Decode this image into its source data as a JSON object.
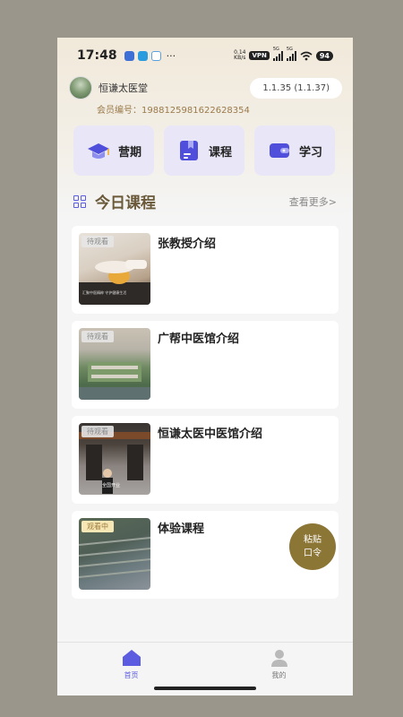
{
  "status_bar": {
    "time": "17:48",
    "dots": "···",
    "net_speed_value": "0.14",
    "net_speed_unit": "KB/s",
    "vpn": "VPN",
    "sig1_tag": "5G",
    "sig2_tag": "5G",
    "battery": "94"
  },
  "header": {
    "org_name": "恒谦太医堂",
    "version": "1.1.35 (1.1.37)",
    "member_label": "会员编号：",
    "member_id": "1988125981622628354"
  },
  "quick_cards": [
    {
      "label": "营期",
      "icon": "graduation-cap-icon"
    },
    {
      "label": "课程",
      "icon": "bookmark-doc-icon"
    },
    {
      "label": "学习",
      "icon": "wallet-icon"
    }
  ],
  "section": {
    "title": "今日课程",
    "more": "查看更多>"
  },
  "courses": [
    {
      "title": "张教授介绍",
      "badge": "待观看",
      "thumb_caption": "汇聚中医精粹 守护健康生活"
    },
    {
      "title": "广帮中医馆介绍",
      "badge": "待观看"
    },
    {
      "title": "恒谦太医中医馆介绍",
      "badge": "待观看",
      "thumb_caption": "全国开业"
    },
    {
      "title": "体验课程",
      "badge": "观看中"
    }
  ],
  "paste_button": {
    "line1": "粘贴",
    "line2": "口令"
  },
  "tabbar": [
    {
      "label": "首页",
      "icon": "home-icon"
    },
    {
      "label": "我的",
      "icon": "user-icon"
    }
  ],
  "colors": {
    "accent": "#5b5ce0",
    "gold": "#8c7636",
    "card_bg": "#e9e7f7"
  }
}
